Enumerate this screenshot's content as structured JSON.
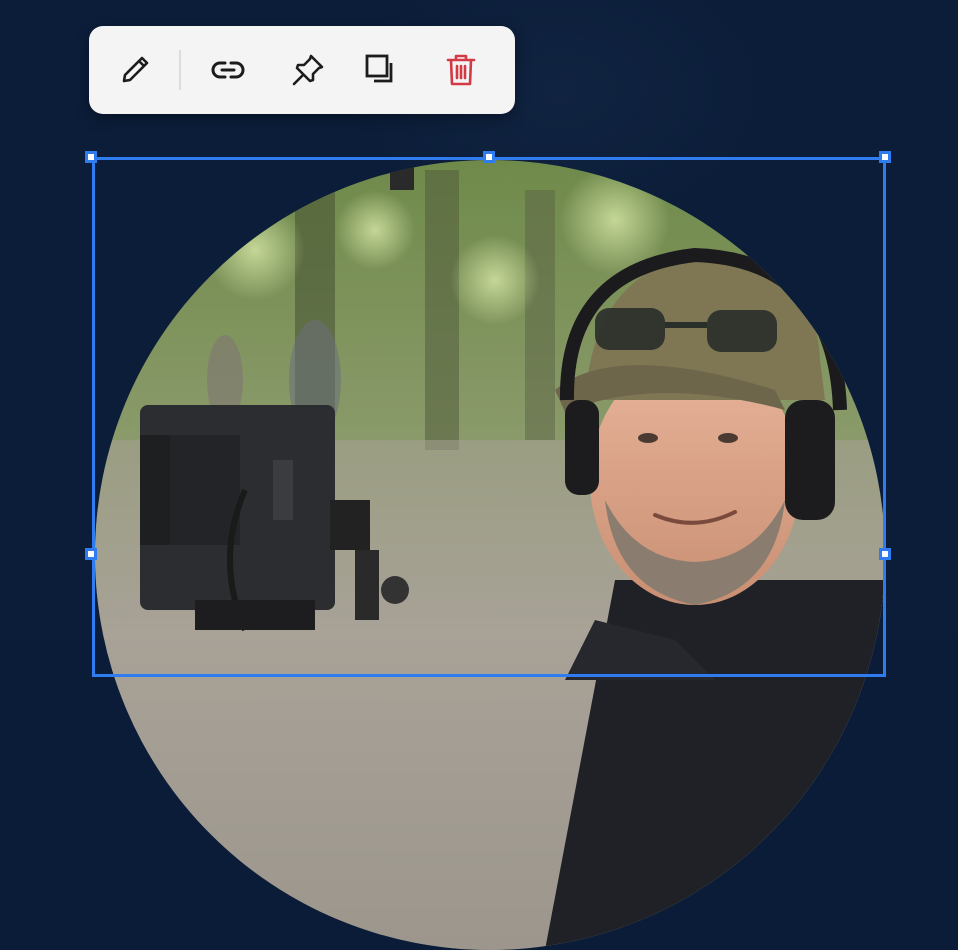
{
  "toolbar": {
    "buttons": [
      {
        "name": "edit-button",
        "icon": "pencil-icon",
        "color": "#1c1c1e"
      },
      {
        "name": "link-button",
        "icon": "link-icon",
        "color": "#1c1c1e"
      },
      {
        "name": "pin-button",
        "icon": "pin-icon",
        "color": "#1c1c1e"
      },
      {
        "name": "duplicate-button",
        "icon": "duplicate-icon",
        "color": "#1c1c1e"
      },
      {
        "name": "delete-button",
        "icon": "trash-icon",
        "color": "#d23b45"
      }
    ]
  },
  "selection": {
    "accent_color": "#2f7bf0"
  },
  "image": {
    "subject": "photo"
  }
}
